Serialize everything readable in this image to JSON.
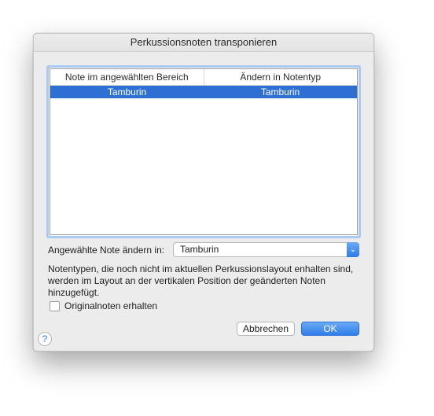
{
  "dialog": {
    "title": "Perkussionsnoten transponieren"
  },
  "table": {
    "columns": [
      "Note im angewählten Bereich",
      "Ändern in Notentyp"
    ],
    "rows": [
      {
        "from": "Tamburin",
        "to": "Tamburin",
        "selected": true
      }
    ]
  },
  "change": {
    "label": "Angewählte Note ändern in:",
    "selected_value": "Tamburin"
  },
  "info_text": "Notentypen, die noch nicht im aktuellen Perkussionslayout enhalten sind, werden im Layout an der vertikalen Position der geänderten Noten hinzugefügt.",
  "keep_original": {
    "label": "Originalnoten erhalten",
    "checked": false
  },
  "buttons": {
    "cancel": "Abbrechen",
    "ok": "OK"
  },
  "help": {
    "glyph": "?",
    "icon": "help-icon"
  },
  "colors": {
    "selection": "#2e6fd4",
    "accent": "#2f7ee9",
    "focus_ring": "#a9c9f0"
  }
}
